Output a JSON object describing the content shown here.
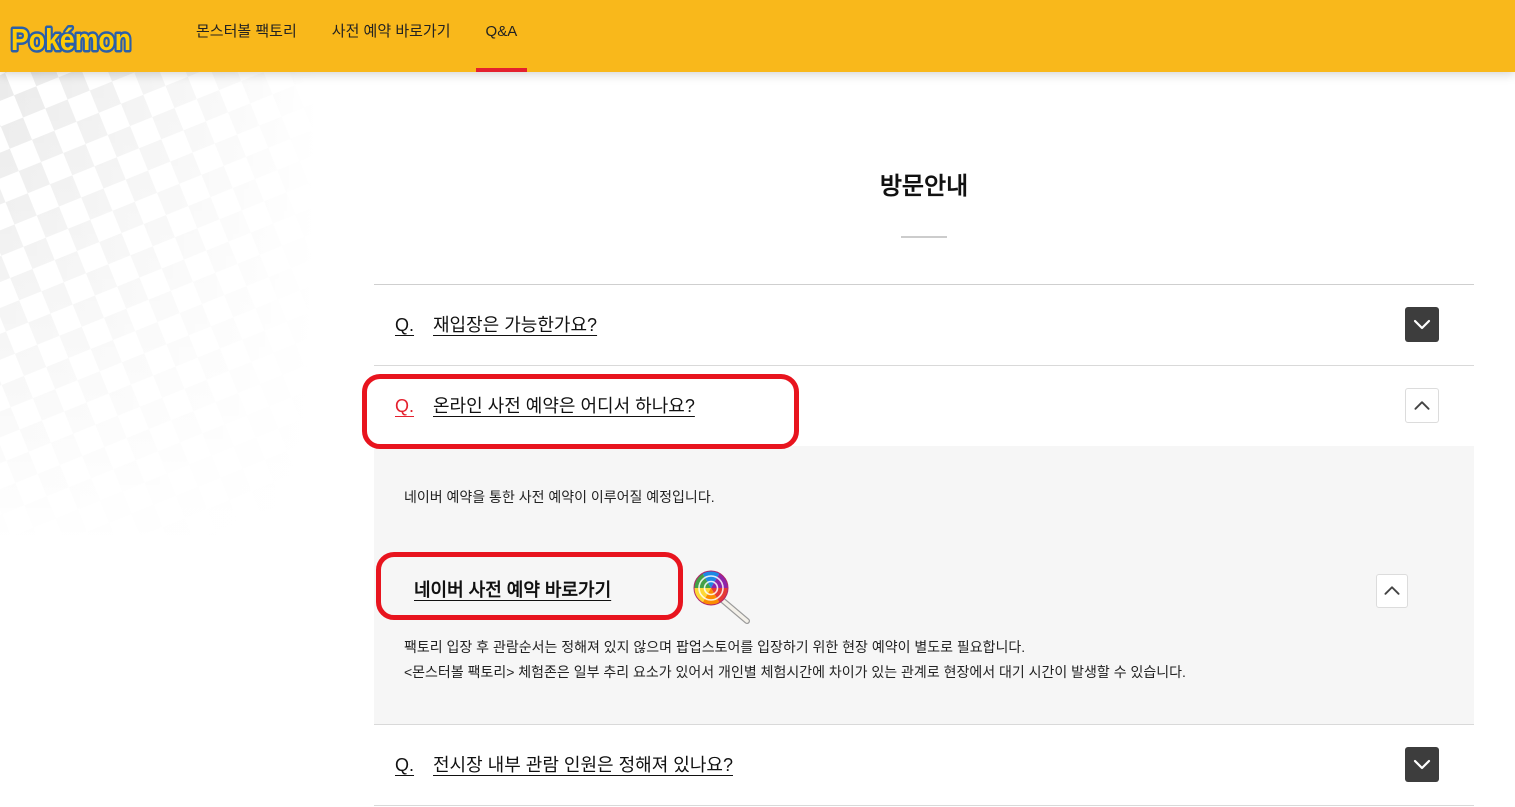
{
  "brand": {
    "logo_text": "Pokémon"
  },
  "nav": {
    "items": [
      {
        "label": "몬스터볼 팩토리",
        "active": false
      },
      {
        "label": "사전 예약 바로가기",
        "active": false
      },
      {
        "label": "Q&A",
        "active": true
      }
    ]
  },
  "page": {
    "title": "방문안내"
  },
  "faq": {
    "items": [
      {
        "marker": "Q.",
        "question": "재입장은 가능한가요?",
        "expanded": false,
        "toggle_icon": "chevron-down-icon"
      },
      {
        "marker": "Q.",
        "question": "온라인 사전 예약은 어디서 하나요?",
        "expanded": true,
        "toggle_icon": "chevron-up-icon",
        "answer": {
          "intro": "네이버 예약을 통한 사전 예약이 이루어질 예정입니다.",
          "link_label": "네이버 사전 예약 바로가기",
          "link_icon": "lollipop-icon",
          "toggle_icon": "chevron-up-icon",
          "notes": [
            "팩토리 입장 후 관람순서는 정해져 있지 않으며 팝업스토어를 입장하기 위한 현장 예약이 별도로 필요합니다.",
            "<몬스터볼 팩토리> 체험존은 일부 추리 요소가 있어서 개인별 체험시간에 차이가 있는 관계로 현장에서 대기 시간이 발생할 수 있습니다."
          ]
        }
      },
      {
        "marker": "Q.",
        "question": "전시장 내부 관람 인원은 정해져 있나요?",
        "expanded": false,
        "toggle_icon": "chevron-down-icon"
      }
    ]
  },
  "colors": {
    "header_bg": "#F9B81B",
    "accent": "#E4202E",
    "toggle_dark": "#3D3D3D",
    "answer_bg": "#F6F6F6",
    "annotation": "#E8141E"
  }
}
